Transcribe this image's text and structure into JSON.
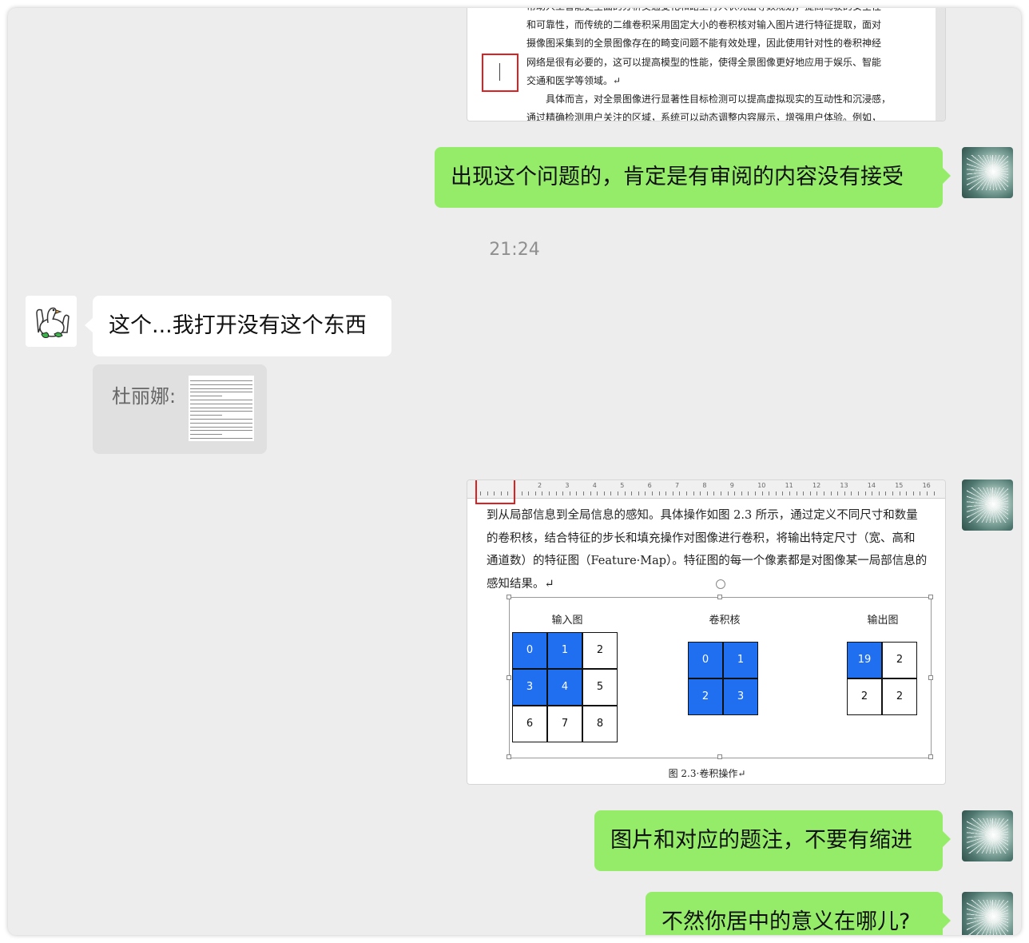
{
  "doc1": {
    "lines": [
      "帮助人工智能更全面的分析交通变化和路上行人状况出等数规划，提高驾驶的安全性",
      "和可靠性，而传统的二维卷积采用固定大小的卷积核对输入图片进行特征提取，面对",
      "摄像图采集到的全景图像存在的畸变问题不能有效处理，因此使用针对性的卷积神经",
      "网络是很有必要的，这可以提高模型的性能，使得全景图像更好地应用于娱乐、智能",
      "交通和医学等领域。↵",
      "具体而言，对全景图像进行显著性目标检测可以提高虚拟现实的互动性和沉浸感，",
      "通过精确检测用户关注的区域，系统可以动态调整内容展示，增强用户体验。例如，"
    ]
  },
  "messages": [
    {
      "text": "出现这个问题的，肯定是有审阅的内容没有接受"
    },
    {
      "time": "21:24"
    },
    {
      "text": "这个...我打开没有这个东西"
    },
    {
      "quote_name": "杜丽娜:"
    },
    {
      "text": "图片和对应的题注，不要有缩进"
    },
    {
      "text": "不然你居中的意义在哪儿?"
    }
  ],
  "doc2": {
    "ruler_numbers": [
      "2",
      "3",
      "4",
      "5",
      "6",
      "7",
      "8",
      "9",
      "10",
      "11",
      "12",
      "13",
      "14",
      "15",
      "16"
    ],
    "lines": [
      "到从局部信息到全局信息的感知。具体操作如图 2.3 所示，通过定义不同尺寸和数量",
      "的卷积核，结合特征的步长和填充操作对图像进行卷积，将输出特定尺寸（宽、高和",
      "通道数）的特征图（Feature·Map）。特征图的每一个像素都是对图像某一局部信息的",
      "感知结果。↵"
    ],
    "figure": {
      "input_label": "输入图",
      "kernel_label": "卷积核",
      "output_label": "输出图",
      "input_grid": [
        "0",
        "1",
        "2",
        "3",
        "4",
        "5",
        "6",
        "7",
        "8"
      ],
      "input_highlight": [
        0,
        1,
        3,
        4
      ],
      "kernel_grid": [
        "0",
        "1",
        "2",
        "3"
      ],
      "output_grid": [
        "19",
        "2",
        "2",
        "2"
      ],
      "output_highlight": [
        0
      ],
      "caption": "图 2.3·卷积操作↵"
    }
  }
}
